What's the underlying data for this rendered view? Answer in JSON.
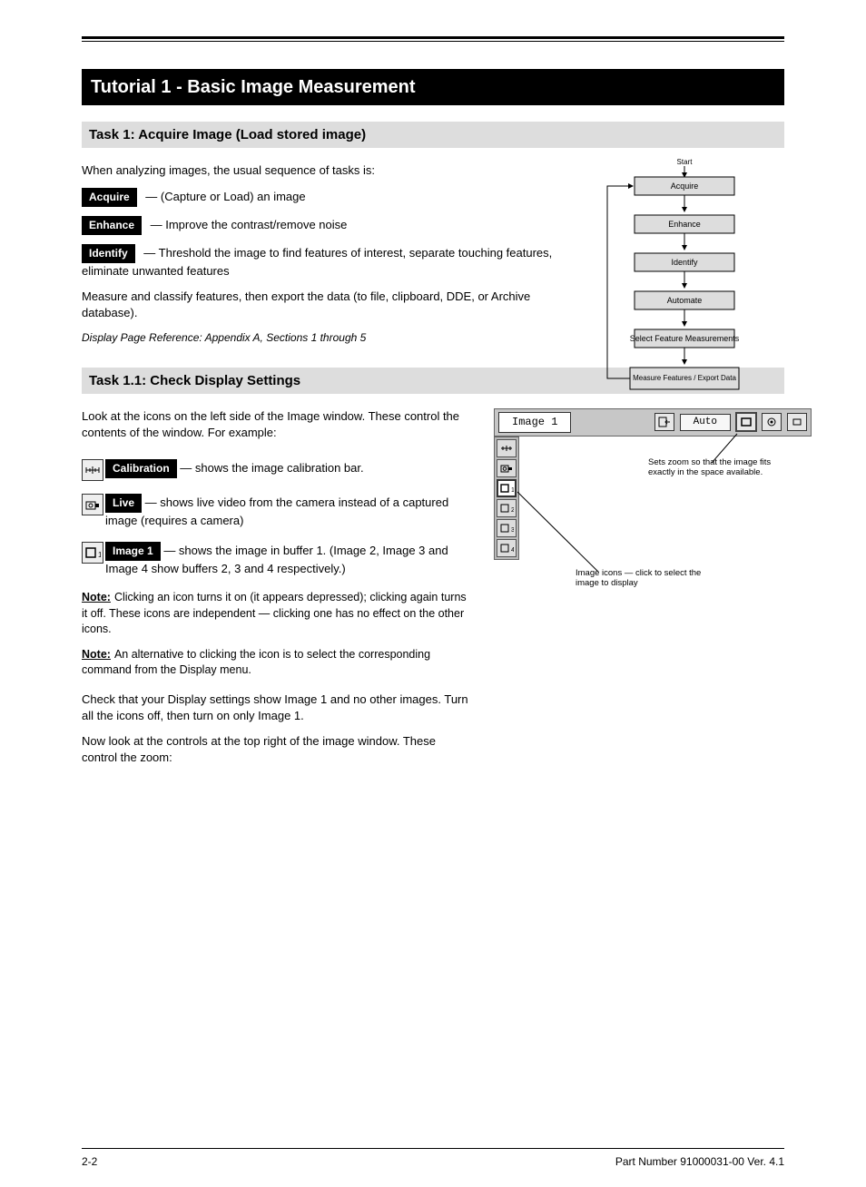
{
  "header": {
    "doc_title": "Tutorial 1 — Basic Image Measurement"
  },
  "main": {
    "banner": "Tutorial 1 - Basic Image Measurement",
    "task1": {
      "heading": "Task 1: Acquire Image (Load stored image)",
      "intro": "When analyzing images, the usual sequence of tasks is:",
      "defs": [
        {
          "label": "Acquire",
          "text": " — (Capture or Load) an image"
        },
        {
          "label": "Enhance",
          "text": " — Improve the contrast/remove noise"
        },
        {
          "label": "Identify",
          "text": " — Threshold the image to find features of interest, separate touching features, eliminate unwanted features"
        }
      ],
      "outro": "Measure and classify features, then export the data (to file, clipboard, DDE, or Archive database).",
      "page_ref": "Display Page Reference: Appendix A, Sections 1 through 5",
      "flow": {
        "step0": "Start",
        "steps": [
          "Acquire",
          "Enhance",
          "Identify",
          "Automate",
          "Select Feature Measurements"
        ],
        "final": "Measure Features / Export Data"
      }
    },
    "task1_1": {
      "heading": "Task 1.1: Check Display Settings",
      "intro": "Look at the icons on the left side of the Image window. These control the contents of the window. For example:",
      "icons": [
        {
          "name": "calibration",
          "label": "Calibration",
          "text": " — shows the image calibration bar."
        },
        {
          "name": "live",
          "label": "Live",
          "text": " — shows live video from the camera instead of a captured image (requires a camera)"
        },
        {
          "name": "image1",
          "label": "Image 1",
          "text": " — shows the image in buffer 1. (Image 2, Image 3 and Image 4 show buffers 2, 3 and 4 respectively.)"
        }
      ],
      "notes": [
        {
          "label": "Note:",
          "text": "Clicking an icon turns it on (it appears depressed); clicking again turns it off. These icons are independent — clicking one has no effect on the other icons."
        },
        {
          "label": "Note:",
          "text": "An alternative to clicking the icon is to select the corresponding command from the Display menu."
        }
      ],
      "check_display": "Check that your Display settings show Image 1 and no other images. Turn all the icons off, then turn on only Image 1.",
      "zoom_intro": "Now look at the controls at the top right of the image window. These control the zoom:",
      "callout_a": "Sets zoom so that the image fits exactly in the space available.",
      "callout_b": "Image icons — click to select the image to display",
      "toolbar": {
        "image_label": "Image 1",
        "auto_label": "Auto"
      }
    }
  },
  "footer": {
    "page_num": "2-2",
    "doc_id": "Part Number 91000031-00 Ver. 4.1"
  }
}
